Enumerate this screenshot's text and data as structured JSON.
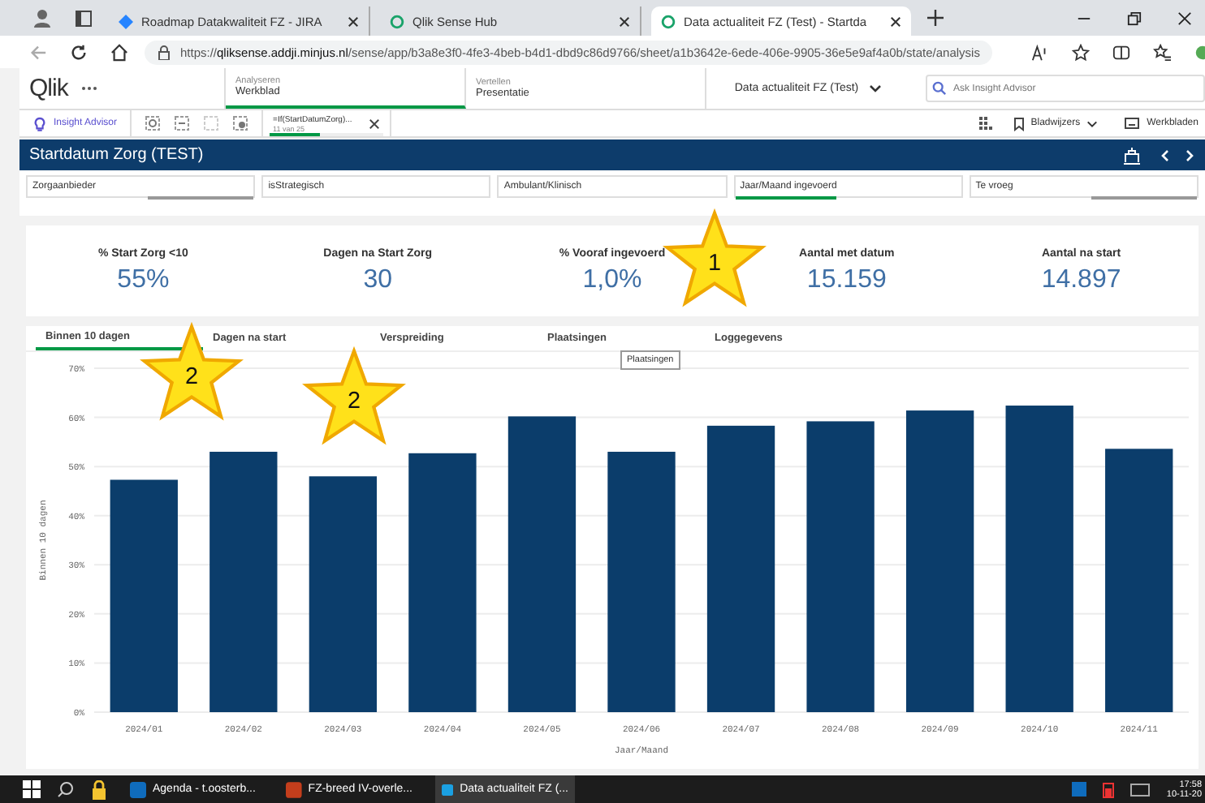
{
  "browser": {
    "tabs": [
      {
        "title": "Roadmap Datakwaliteit FZ - JIRA",
        "kind": "jira",
        "selected": false
      },
      {
        "title": "Qlik Sense Hub",
        "kind": "qlik",
        "selected": false
      },
      {
        "title": "Data actualiteit FZ (Test) - Startda",
        "kind": "qlik",
        "selected": true
      }
    ],
    "url_prefix": "https://",
    "url_host": "qliksense.addji.minjus.nl",
    "url_path": "/sense/app/b3a8e3f0-4fe3-4beb-b4d1-dbd9c86d9766/sheet/a1b3642e-6ede-406e-9905-36e5e9af4a0b/state/analysis"
  },
  "qlik": {
    "logo": "Qlik",
    "modes": [
      {
        "top": "Analyseren",
        "label": "Werkblad",
        "selected": true
      },
      {
        "top": "Vertellen",
        "label": "Presentatie",
        "selected": false
      }
    ],
    "app_title": "Data actualiteit FZ (Test)",
    "search": {
      "placeholder": "Ask Insight Advisor"
    },
    "insight_button": "Insight Advisor",
    "selection": {
      "field": "=If(StartDatumZorg)...",
      "count": "11 van 25",
      "level": 0.45
    },
    "bookmarks": "Bladwijzers",
    "sheets": "Werkbladen"
  },
  "sheet": {
    "title": "Startdatum Zorg (TEST)",
    "filters": [
      {
        "label": "Zorgaanbieder",
        "selected": false,
        "excluded": true
      },
      {
        "label": "isStrategisch",
        "selected": false,
        "excluded": false
      },
      {
        "label": "Ambulant/Klinisch",
        "selected": false,
        "excluded": false
      },
      {
        "label": "Jaar/Maand ingevoerd",
        "selected": true,
        "excluded": false
      },
      {
        "label": "Te vroeg",
        "selected": false,
        "excluded": true
      }
    ],
    "kpis": [
      {
        "label": "% Start Zorg <10",
        "value": "55%"
      },
      {
        "label": "Dagen na Start Zorg",
        "value": "30"
      },
      {
        "label": "% Vooraf ingevoerd",
        "value": "1,0%"
      },
      {
        "label": "Aantal met datum",
        "value": "15.159"
      },
      {
        "label": "Aantal na start",
        "value": "14.897"
      }
    ],
    "tabs": [
      {
        "label": "Binnen 10 dagen",
        "selected": true
      },
      {
        "label": "Dagen na start",
        "selected": false
      },
      {
        "label": "Verspreiding",
        "selected": false
      },
      {
        "label": "Plaatsingen",
        "selected": false
      },
      {
        "label": "Loggegevens",
        "selected": false
      }
    ],
    "tooltip": "Plaatsingen",
    "chart_data": {
      "type": "bar",
      "xlabel": "Jaar/Maand",
      "ylabel": "Binnen 10 dagen",
      "categories": [
        "2024/01",
        "2024/02",
        "2024/03",
        "2024/04",
        "2024/05",
        "2024/06",
        "2024/07",
        "2024/08",
        "2024/09",
        "2024/10",
        "2024/11"
      ],
      "values": [
        47.3,
        53,
        48,
        52.7,
        60.2,
        53,
        58.3,
        59.2,
        61.4,
        62.4,
        53.6
      ],
      "ylim": [
        0,
        70
      ],
      "grid": true,
      "yticks": [
        {
          "value": 0,
          "label": "0%"
        },
        {
          "value": 10,
          "label": "10%"
        },
        {
          "value": 20,
          "label": "20%"
        },
        {
          "value": 30,
          "label": "30%"
        },
        {
          "value": 40,
          "label": "40%"
        },
        {
          "value": 50,
          "label": "50%"
        },
        {
          "value": 60,
          "label": "60%"
        },
        {
          "value": 70,
          "label": "70%"
        }
      ]
    }
  },
  "annotations": [
    {
      "label": "1"
    },
    {
      "label": "2"
    },
    {
      "label": "2"
    }
  ],
  "taskbar": {
    "apps": [
      {
        "label": "Agenda - t.oosterb...",
        "kind": "outlook",
        "selected": false
      },
      {
        "label": "FZ-breed IV-overle...",
        "kind": "powerpoint",
        "selected": false
      },
      {
        "label": "Data actualiteit FZ (...",
        "kind": "edge",
        "selected": true
      }
    ],
    "time": "17:58",
    "date": "10-11-20"
  }
}
